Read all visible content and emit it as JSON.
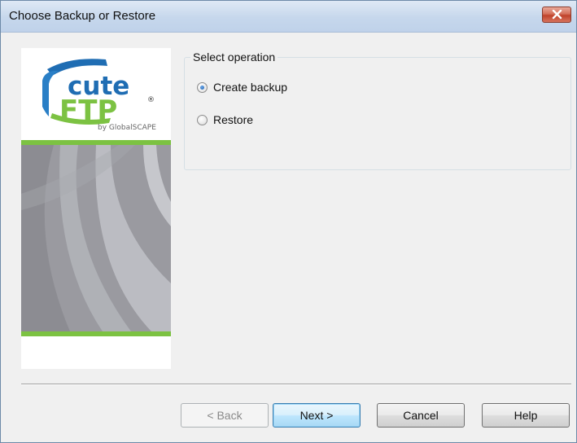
{
  "window": {
    "title": "Choose Backup or Restore"
  },
  "branding": {
    "logo_cute": "cute",
    "logo_ftp": "FTP",
    "logo_registered": "®",
    "logo_by": "by GlobalSCAPE",
    "accent_green": "#7cc242",
    "logo_blue": "#1f6db3"
  },
  "operation_group": {
    "label": "Select operation",
    "options": [
      {
        "label": "Create backup",
        "selected": true
      },
      {
        "label": "Restore",
        "selected": false
      }
    ]
  },
  "buttons": {
    "back": "< Back",
    "next": "Next >",
    "cancel": "Cancel",
    "help": "Help"
  },
  "icons": {
    "close": "close-icon",
    "logo": "cuteftp-logo"
  }
}
